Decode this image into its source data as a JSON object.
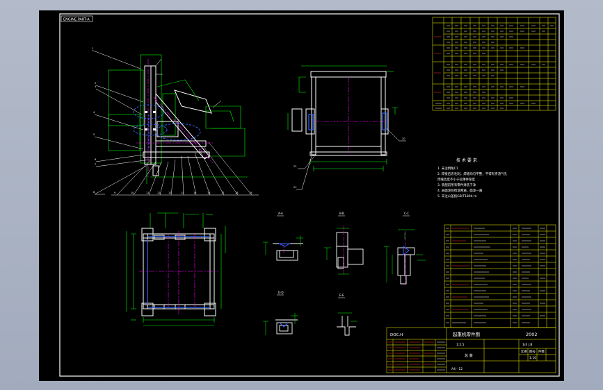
{
  "drawing": {
    "corner_tag": "ENGINE.PART-A",
    "title_cn": "起重机零件图",
    "title_code": "2002",
    "title_left": "DOC.H",
    "block_cells": [
      "1:2.5",
      "1/4 J.B",
      "比例",
      "图号",
      "件数",
      "1:10"
    ],
    "foot_code": "A4 - 12",
    "section_labels": [
      "A-A",
      "B-B",
      "C-C",
      "D-D",
      "E-E"
    ],
    "notes_title": "技 术 要 求",
    "notes_lines": [
      "1. 未注倒角C1",
      "2. 焊接后去毛刺，焊缝均匀平整，不得有夹渣气孔",
      "   焊缝高度不小于较薄件厚度",
      "3. 装配前所有零件清洗干净",
      "4. 表面涂防锈漆两遍，面漆一遍",
      "5. 未注公差按GB/T1804-m"
    ]
  },
  "colors": {
    "background": "#000000",
    "frame": "#ffffff",
    "table": "#ffff00",
    "dimension": "#00ff00",
    "center": "#ff00ff",
    "hidden": "#3366ff",
    "text_red": "#ff3333"
  }
}
